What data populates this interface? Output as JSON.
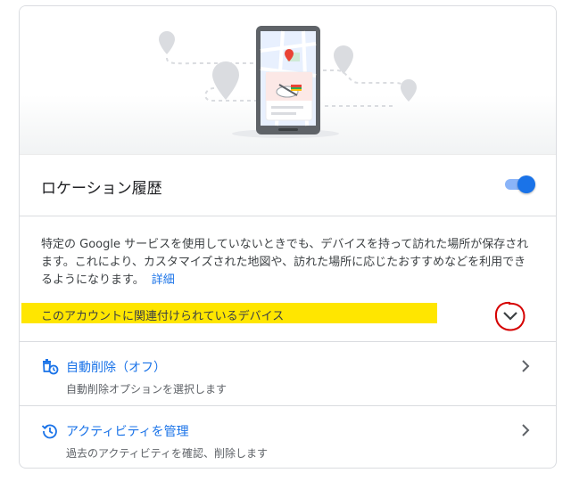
{
  "location_history": {
    "title": "ロケーション履歴",
    "enabled": true
  },
  "description": {
    "text": "特定の Google サービスを使用していないときでも、デバイスを持って訪れた場所が保存されます。これにより、カスタマイズされた地図や、訪れた場所に応じたおすすめなどを利用できるようになります。",
    "link_label": "詳細"
  },
  "devices": {
    "label": "このアカウントに関連付けられているデバイス"
  },
  "menu": [
    {
      "title": "自動削除（オフ）",
      "subtitle": "自動削除オプションを選択します",
      "icon": "auto-delete-icon"
    },
    {
      "title": "アクティビティを管理",
      "subtitle": "過去のアクティビティを確認、削除します",
      "icon": "history-icon"
    }
  ],
  "colors": {
    "accent": "#1a73e8",
    "highlight": "#ffe600",
    "annotation": "#d50000"
  }
}
